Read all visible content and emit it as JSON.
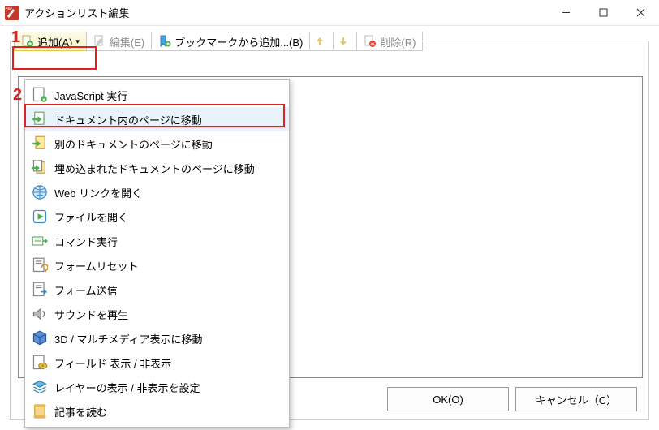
{
  "window": {
    "title": "アクションリスト編集"
  },
  "toolbar": {
    "add": "追加(A)",
    "edit": "編集(E)",
    "addFromBookmark": "ブックマークから追加...(B)",
    "delete": "削除(R)"
  },
  "menu": {
    "items": [
      "JavaScript 実行",
      "ドキュメント内のページに移動",
      "別のドキュメントのページに移動",
      "埋め込まれたドキュメントのページに移動",
      "Web リンクを開く",
      "ファイルを開く",
      "コマンド実行",
      "フォームリセット",
      "フォーム送信",
      "サウンドを再生",
      "3D / マルチメディア表示に移動",
      "フィールド 表示 / 非表示",
      "レイヤーの表示 / 非表示を設定",
      "記事を読む"
    ],
    "selectedIndex": 1
  },
  "annotations": {
    "one": "1",
    "two": "2"
  },
  "buttons": {
    "ok": "OK(O)",
    "cancel": "キャンセル（C）"
  }
}
